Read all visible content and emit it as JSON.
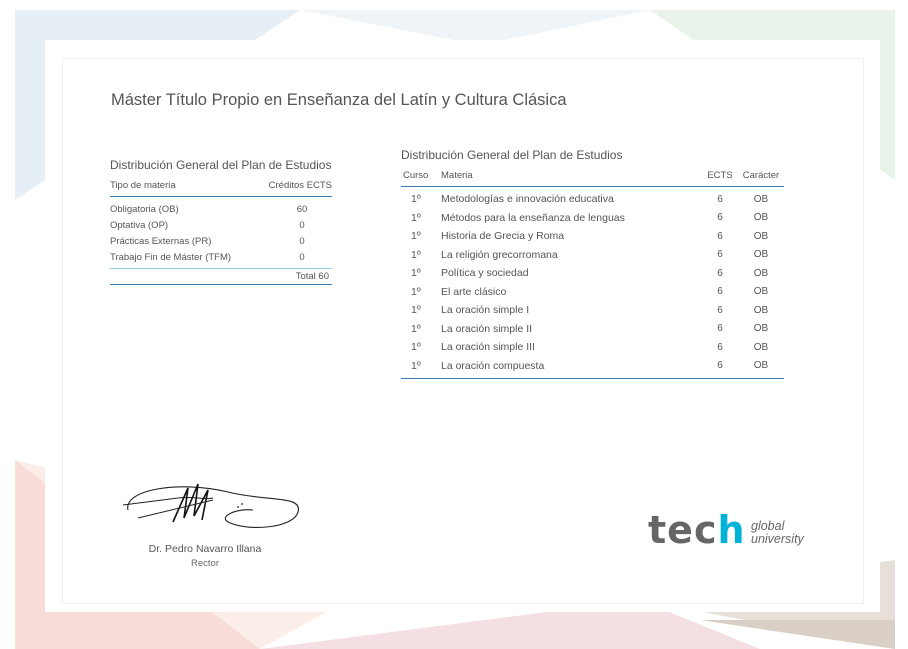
{
  "document": {
    "title": "Máster Título Propio en Enseñanza del Latín y Cultura Clásica"
  },
  "summary_table": {
    "title": "Distribución General del Plan de Estudios",
    "headers": [
      "Tipo de materia",
      "Créditos ECTS"
    ],
    "rows": [
      {
        "type": "Obligatoria (OB)",
        "credits": "60"
      },
      {
        "type": "Optativa (OP)",
        "credits": "0"
      },
      {
        "type": "Prácticas Externas (PR)",
        "credits": "0"
      },
      {
        "type": "Trabajo Fin de Máster (TFM)",
        "credits": "0"
      }
    ],
    "total": "Total 60"
  },
  "plan_table": {
    "title": "Distribución General del Plan de Estudios",
    "headers": [
      "Curso",
      "Materia",
      "ECTS",
      "Carácter"
    ],
    "rows": [
      {
        "curso": "1º",
        "materia": "Metodologías e innovación educativa",
        "ects": "6",
        "caracter": "OB"
      },
      {
        "curso": "1º",
        "materia": "Métodos para la enseñanza de lenguas",
        "ects": "6",
        "caracter": "OB"
      },
      {
        "curso": "1º",
        "materia": "Historia de Grecia y Roma",
        "ects": "6",
        "caracter": "OB"
      },
      {
        "curso": "1º",
        "materia": "La religión grecorromana",
        "ects": "6",
        "caracter": "OB"
      },
      {
        "curso": "1º",
        "materia": "Política y sociedad",
        "ects": "6",
        "caracter": "OB"
      },
      {
        "curso": "1º",
        "materia": "El arte clásico",
        "ects": "6",
        "caracter": "OB"
      },
      {
        "curso": "1º",
        "materia": "La oración simple I",
        "ects": "6",
        "caracter": "OB"
      },
      {
        "curso": "1º",
        "materia": "La oración simple II",
        "ects": "6",
        "caracter": "OB"
      },
      {
        "curso": "1º",
        "materia": "La oración simple III",
        "ects": "6",
        "caracter": "OB"
      },
      {
        "curso": "1º",
        "materia": "La oración compuesta",
        "ects": "6",
        "caracter": "OB"
      }
    ]
  },
  "signer": {
    "name": "Dr. Pedro Navarro Illana",
    "role": "Rector"
  },
  "logo": {
    "word": "tech",
    "line1": "global",
    "line2": "university",
    "accent_color": "#00b3d6"
  }
}
